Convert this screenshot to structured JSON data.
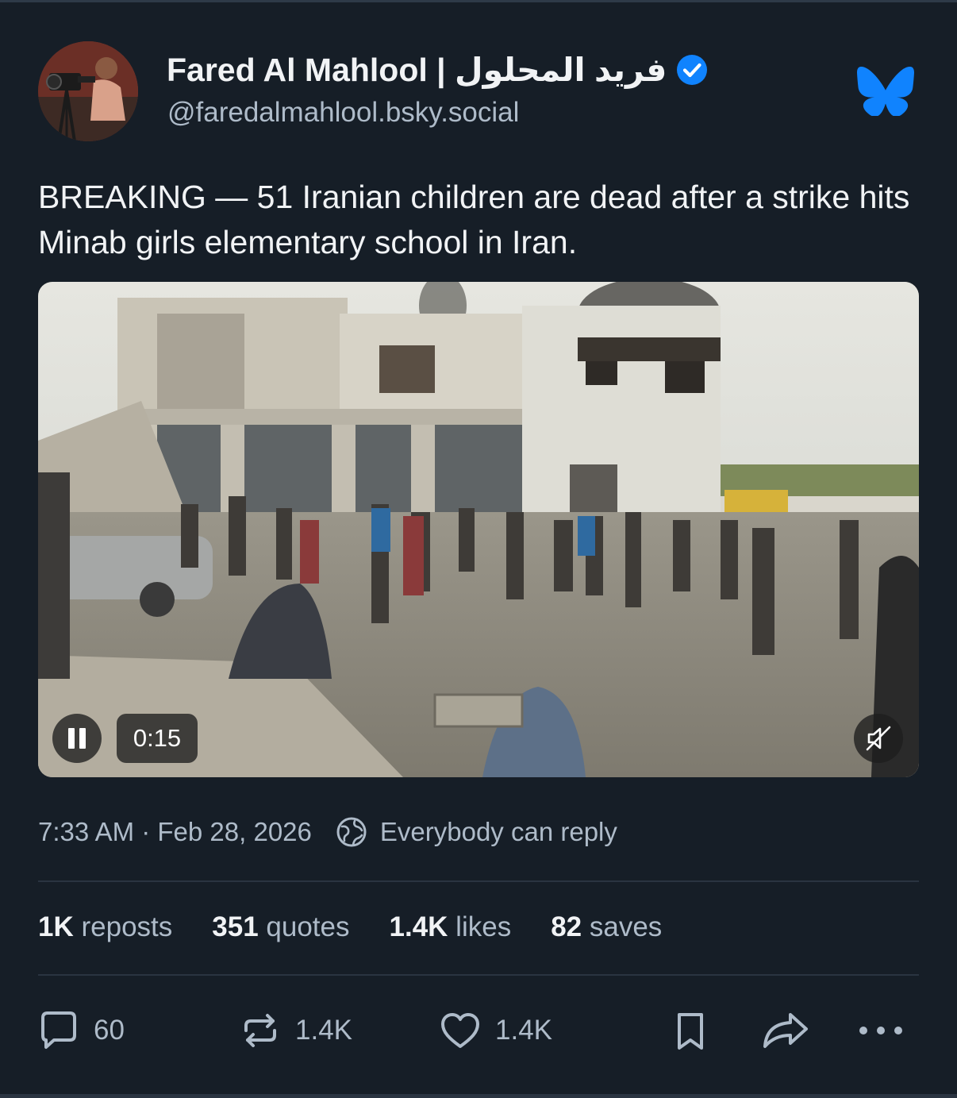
{
  "author": {
    "display_name": "Fared Al Mahlool | فريد المحلول",
    "handle": "@faredalmahlool.bsky.social",
    "verified": true,
    "avatar_icon": "avatar-photographer"
  },
  "app_logo_icon": "bluesky-butterfly-icon",
  "post": {
    "text": "BREAKING — 51 Iranian children are dead after a strike hits Minab girls elementary school in Iran."
  },
  "video": {
    "elapsed": "0:15",
    "playing": true,
    "muted": true
  },
  "meta": {
    "timestamp": "7:33 AM · Feb 28, 2026",
    "reply_setting": "Everybody can reply"
  },
  "stats": {
    "reposts_count": "1K",
    "reposts_label": "reposts",
    "quotes_count": "351",
    "quotes_label": "quotes",
    "likes_count": "1.4K",
    "likes_label": "likes",
    "saves_count": "82",
    "saves_label": "saves"
  },
  "actions": {
    "reply_count": "60",
    "repost_count": "1.4K",
    "like_count": "1.4K"
  },
  "colors": {
    "background": "#161e27",
    "text_primary": "#f1f3f5",
    "text_secondary": "#aebbc9",
    "accent_blue": "#1083fe"
  }
}
